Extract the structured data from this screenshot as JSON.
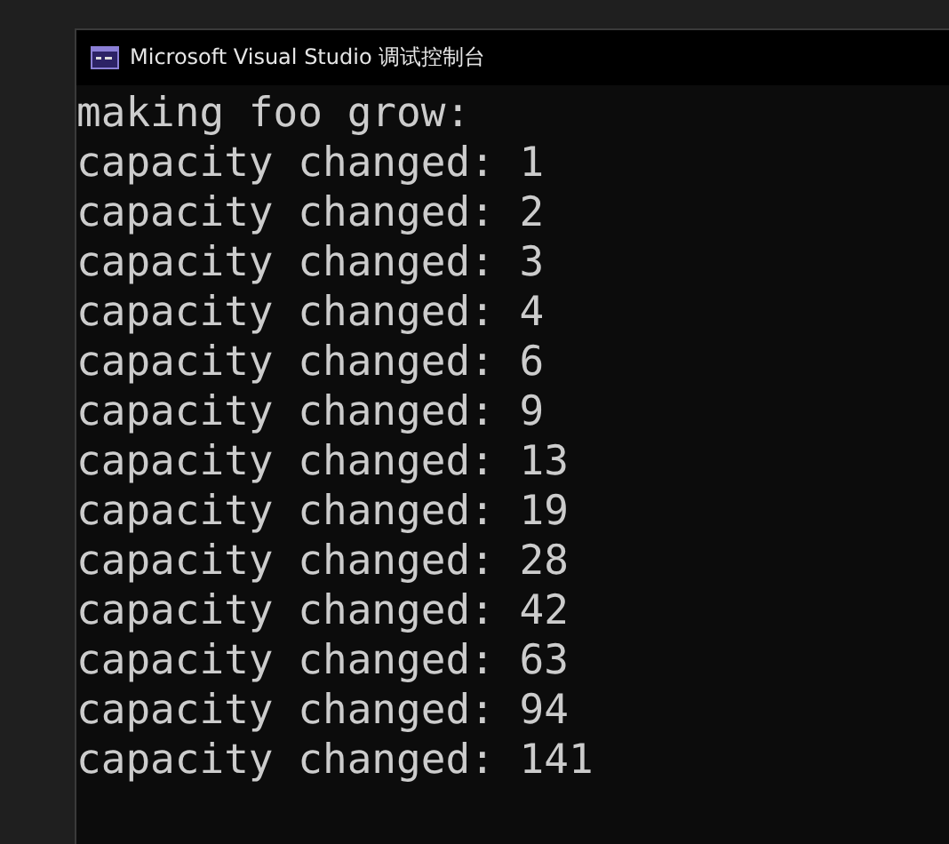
{
  "window": {
    "title": "Microsoft Visual Studio 调试控制台"
  },
  "console_lines": [
    "making foo grow:",
    "capacity changed: 1",
    "capacity changed: 2",
    "capacity changed: 3",
    "capacity changed: 4",
    "capacity changed: 6",
    "capacity changed: 9",
    "capacity changed: 13",
    "capacity changed: 19",
    "capacity changed: 28",
    "capacity changed: 42",
    "capacity changed: 63",
    "capacity changed: 94",
    "capacity changed: 141"
  ]
}
